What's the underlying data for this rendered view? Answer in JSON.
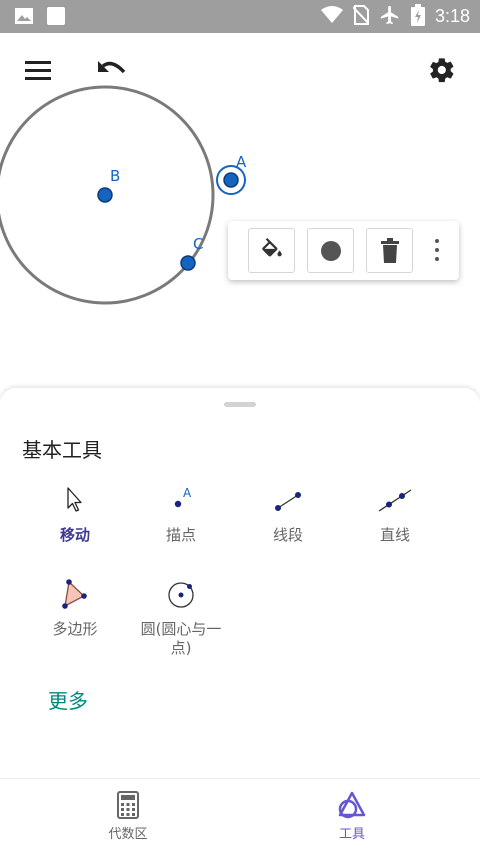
{
  "status_bar": {
    "time": "3:18",
    "icons": [
      "image-icon",
      "square-icon",
      "wifi-icon",
      "no-sim-icon",
      "airplane-icon",
      "battery-icon"
    ]
  },
  "toolbar": {
    "icons": [
      "menu-icon",
      "undo-icon",
      "settings-icon"
    ]
  },
  "canvas": {
    "points": [
      {
        "label": "A"
      },
      {
        "label": "B"
      },
      {
        "label": "C"
      }
    ],
    "point_color": "#1565c0",
    "circle_color": "#7a7a7a"
  },
  "style_popup": {
    "icons": [
      "fill-color-icon",
      "point-style-icon",
      "delete-icon",
      "more-vert-icon"
    ]
  },
  "tools_panel": {
    "title": "基本工具",
    "tools": [
      {
        "label": "移动",
        "icon": "move-cursor-icon",
        "active": true
      },
      {
        "label": "描点",
        "icon": "point-icon"
      },
      {
        "label": "线段",
        "icon": "segment-icon"
      },
      {
        "label": "直线",
        "icon": "line-icon"
      },
      {
        "label": "多边形",
        "icon": "polygon-icon"
      },
      {
        "label_line1": "圆(圆心与一",
        "label_line2": "点)",
        "icon": "circle-center-point-icon"
      }
    ],
    "more": "更多"
  },
  "bottom_nav": {
    "items": [
      {
        "label": "代数区",
        "icon": "calculator-icon"
      },
      {
        "label": "工具",
        "icon": "tools-icon",
        "active": true
      }
    ],
    "active_color": "#6557d2",
    "inactive_color": "#666666"
  }
}
